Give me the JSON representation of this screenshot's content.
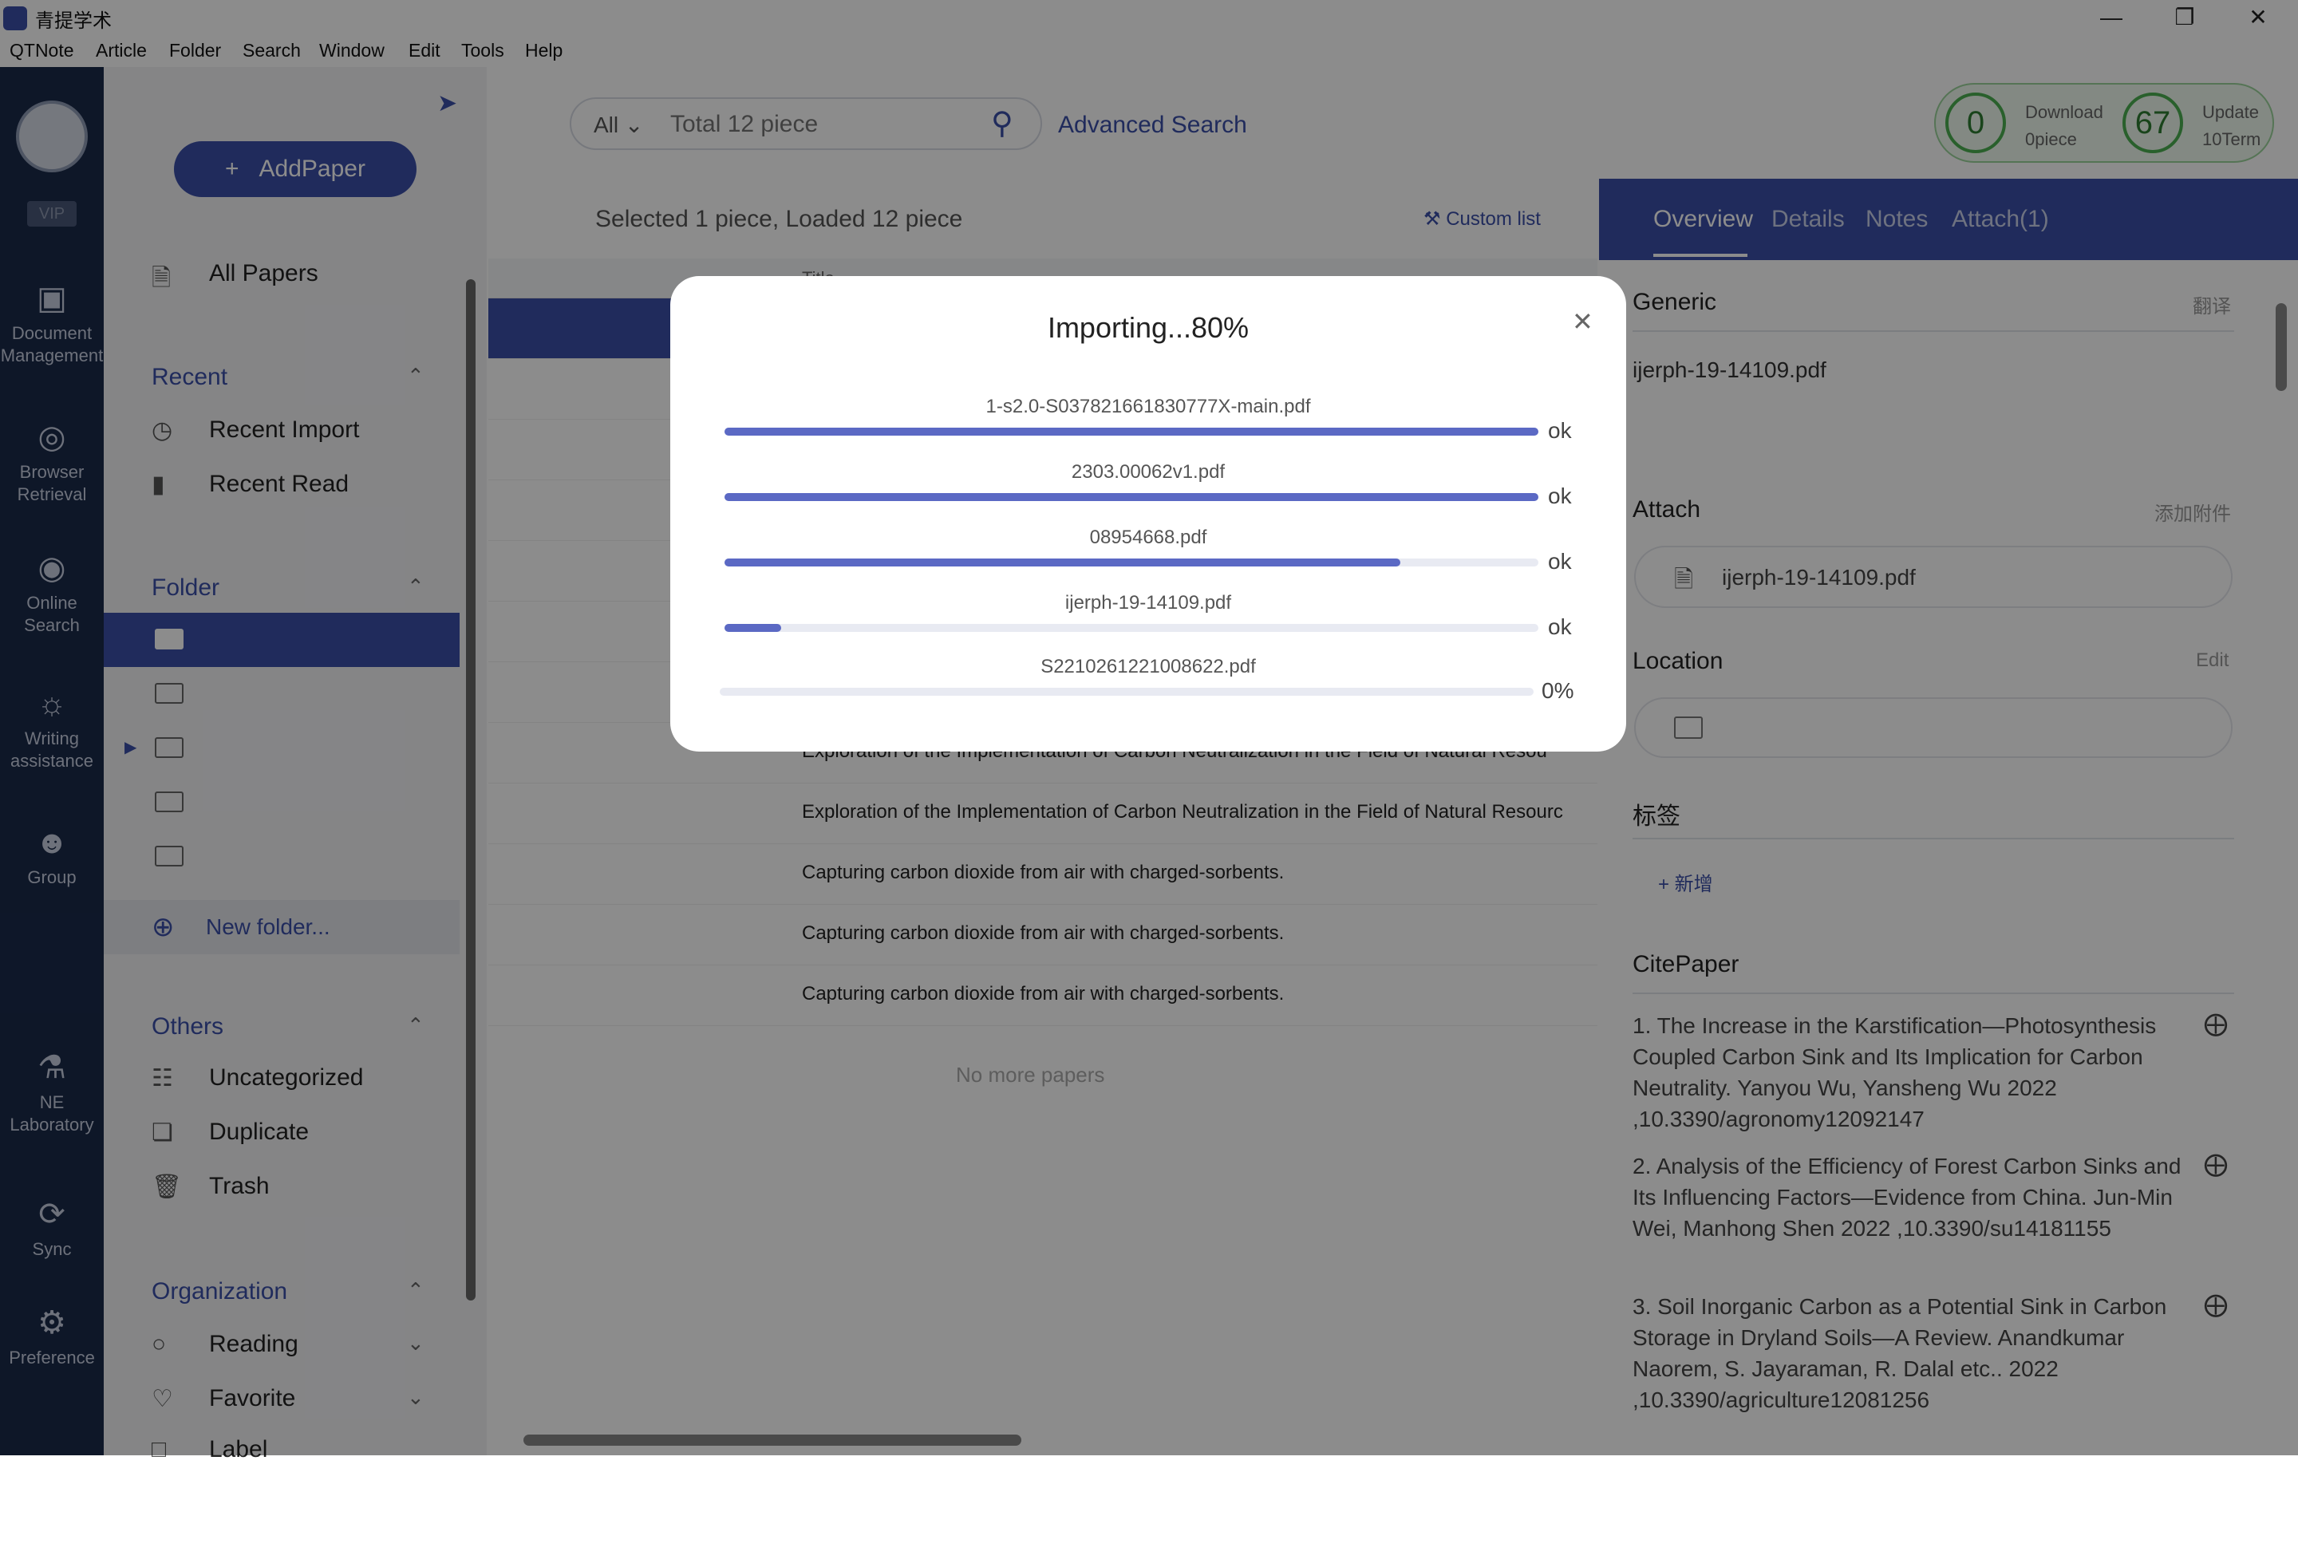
{
  "window": {
    "title": "青提学术",
    "minimize_icon": "minimize-icon",
    "maximize_icon": "restore-icon",
    "close_icon": "close-icon"
  },
  "menu": [
    "QTNote",
    "Article",
    "Folder",
    "Search",
    "Window",
    "Edit",
    "Tools",
    "Help"
  ],
  "nav": {
    "vip": "VIP",
    "items": [
      {
        "label": "Document Management",
        "icon": "cube-icon"
      },
      {
        "label": "Browser Retrieval",
        "icon": "globe-icon"
      },
      {
        "label": "Online Search",
        "icon": "eye-icon"
      },
      {
        "label": "Writing assistance",
        "icon": "bulb-icon"
      },
      {
        "label": "Group",
        "icon": "people-icon"
      },
      {
        "label": "NE Laboratory",
        "icon": "microscope-icon"
      },
      {
        "label": "Sync",
        "icon": "sync-icon"
      },
      {
        "label": "Preference",
        "icon": "gear-icon"
      }
    ]
  },
  "sidebar": {
    "add_paper": "AddPaper",
    "all_papers": "All Papers",
    "recent_header": "Recent",
    "recent_import": "Recent Import",
    "recent_read": "Recent Read",
    "folder_header": "Folder",
    "new_folder": "New folder...",
    "others_header": "Others",
    "uncategorized": "Uncategorized",
    "duplicate": "Duplicate",
    "trash": "Trash",
    "organization_header": "Organization",
    "reading": "Reading",
    "favorite": "Favorite",
    "label": "Label"
  },
  "search": {
    "scope": "All",
    "placeholder": "Total 12 piece",
    "advanced": "Advanced Search"
  },
  "stats": {
    "download_count": "0",
    "download_label": "Download",
    "download_sub": "0piece",
    "update_count": "67",
    "update_label": "Update",
    "update_sub": "10Term"
  },
  "list": {
    "status": "Selected 1 piece,  Loaded 12 piece",
    "custom_list": "Custom list",
    "title_header": "Title",
    "rows": [
      "Exploration of the Implementation of Carbon Neutralization in the Field of Natural Resou",
      "Exploration of the Implementation of Carbon Neutralization in the Field of Natural Resourc",
      "Capturing carbon dioxide from air with charged-sorbents.",
      "Capturing carbon dioxide from air with charged-sorbents.",
      "Capturing carbon dioxide from air with charged-sorbents."
    ],
    "no_more": "No more papers"
  },
  "panel": {
    "tabs": [
      "Overview",
      "Details",
      "Notes",
      "Attach(1)"
    ],
    "generic_header": "Generic",
    "translate": "翻译",
    "generic_file": "ijerph-19-14109.pdf",
    "attach_header": "Attach",
    "add_attach": "添加附件",
    "attach_file": "ijerph-19-14109.pdf",
    "location_header": "Location",
    "location_edit": "Edit",
    "tags_header": "标签",
    "add_tag": "+ 新增",
    "cite_header": "CitePaper",
    "cites": [
      "1. The Increase in the Karstification—Photosynthesis Coupled Carbon Sink and Its Implication for Carbon Neutrality. Yanyou Wu, Yansheng Wu 2022 ,10.3390/agronomy12092147",
      "2. Analysis of the Efficiency of Forest Carbon Sinks and Its Influencing Factors—Evidence from China. Jun-Min Wei, Manhong Shen 2022 ,10.3390/su14181155",
      "3. Soil Inorganic Carbon as a Potential Sink in Carbon Storage in Dryland Soils—A Review. Anandkumar Naorem, S. Jayaraman, R. Dalal etc.. 2022 ,10.3390/agriculture12081256"
    ]
  },
  "dialog": {
    "title": "Importing...80%",
    "files": [
      {
        "name": "1-s2.0-S037821661830777X-main.pdf",
        "progress": 1.0,
        "status": "ok"
      },
      {
        "name": "2303.00062v1.pdf",
        "progress": 1.0,
        "status": "ok"
      },
      {
        "name": "08954668.pdf",
        "progress": 0.83,
        "status": "ok"
      },
      {
        "name": "ijerph-19-14109.pdf",
        "progress": 0.07,
        "status": "ok"
      },
      {
        "name": "S2210261221008622.pdf",
        "progress": 0.0,
        "status": "0%"
      }
    ]
  },
  "colors": {
    "accent": "#3b4fa8",
    "nav_bg": "#1a2a4a",
    "progress": "#5b69c4"
  }
}
